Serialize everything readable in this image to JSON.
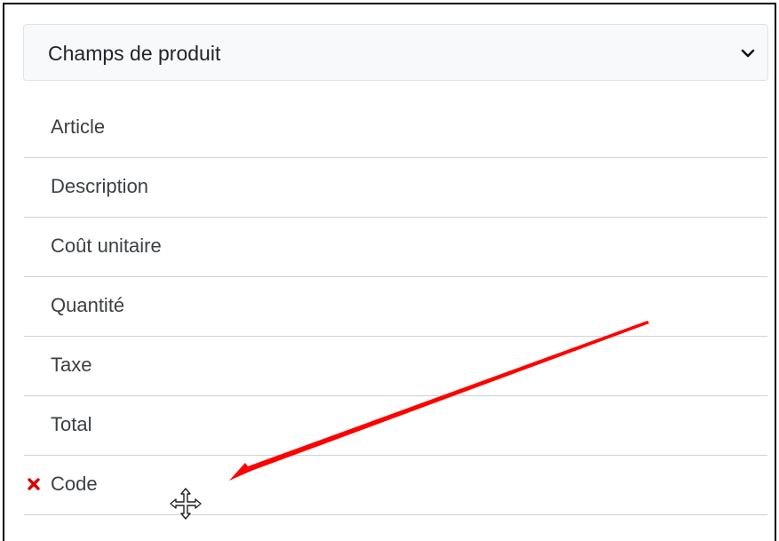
{
  "product_fields": {
    "selector": {
      "selected": "Champs de produit"
    },
    "items": [
      {
        "label": "Article",
        "removable": false
      },
      {
        "label": "Description",
        "removable": false
      },
      {
        "label": "Coût unitaire",
        "removable": false
      },
      {
        "label": "Quantité",
        "removable": false
      },
      {
        "label": "Taxe",
        "removable": false
      },
      {
        "label": "Total",
        "removable": false
      },
      {
        "label": "Code",
        "removable": true
      }
    ]
  },
  "icons": {
    "selector_chevron": "chevron-down-icon",
    "remove": "close-icon",
    "cursor": "move-cursor-icon",
    "annotation": "red-arrow"
  },
  "colors": {
    "remove_icon": "#e00000",
    "annotation_arrow": "#ff0000",
    "select_background": "#f8f9fa",
    "divider": "#cfd2d6"
  }
}
